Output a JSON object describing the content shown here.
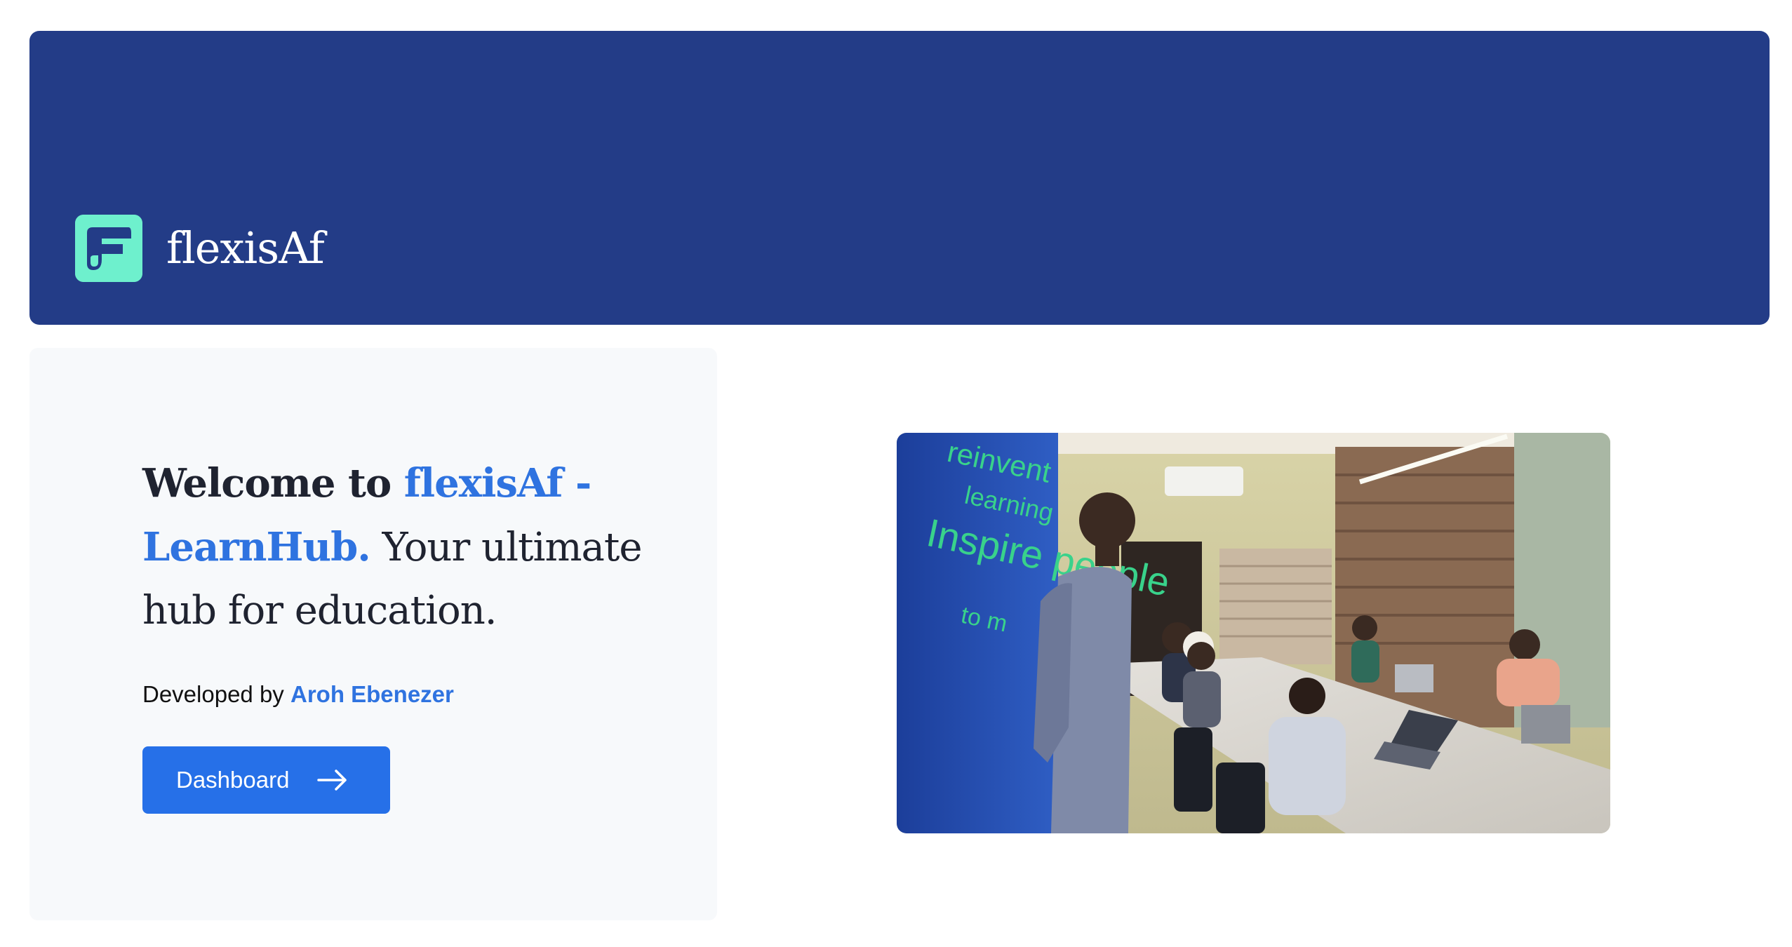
{
  "header": {
    "brand_name": "flexisAf",
    "logo_icon": "flexisaf-logo-icon",
    "background_color": "#233c87",
    "logo_color": "#6ef0cd"
  },
  "hero": {
    "title_prefix": "Welcome to ",
    "title_highlight": "flexisAf - LearnHub.",
    "title_suffix": " Your ultimate hub for education.",
    "credit_prefix": "Developed by ",
    "credit_author": "Aroh Ebenezer",
    "accent_color": "#2f73e0",
    "cta": {
      "label": "Dashboard",
      "icon": "arrow-right-icon",
      "color": "#2670e8"
    }
  },
  "photo": {
    "wall_text_1": "reinvent",
    "wall_text_2": "learning",
    "wall_text_3": "Inspire people",
    "wall_text_4": "to m"
  }
}
